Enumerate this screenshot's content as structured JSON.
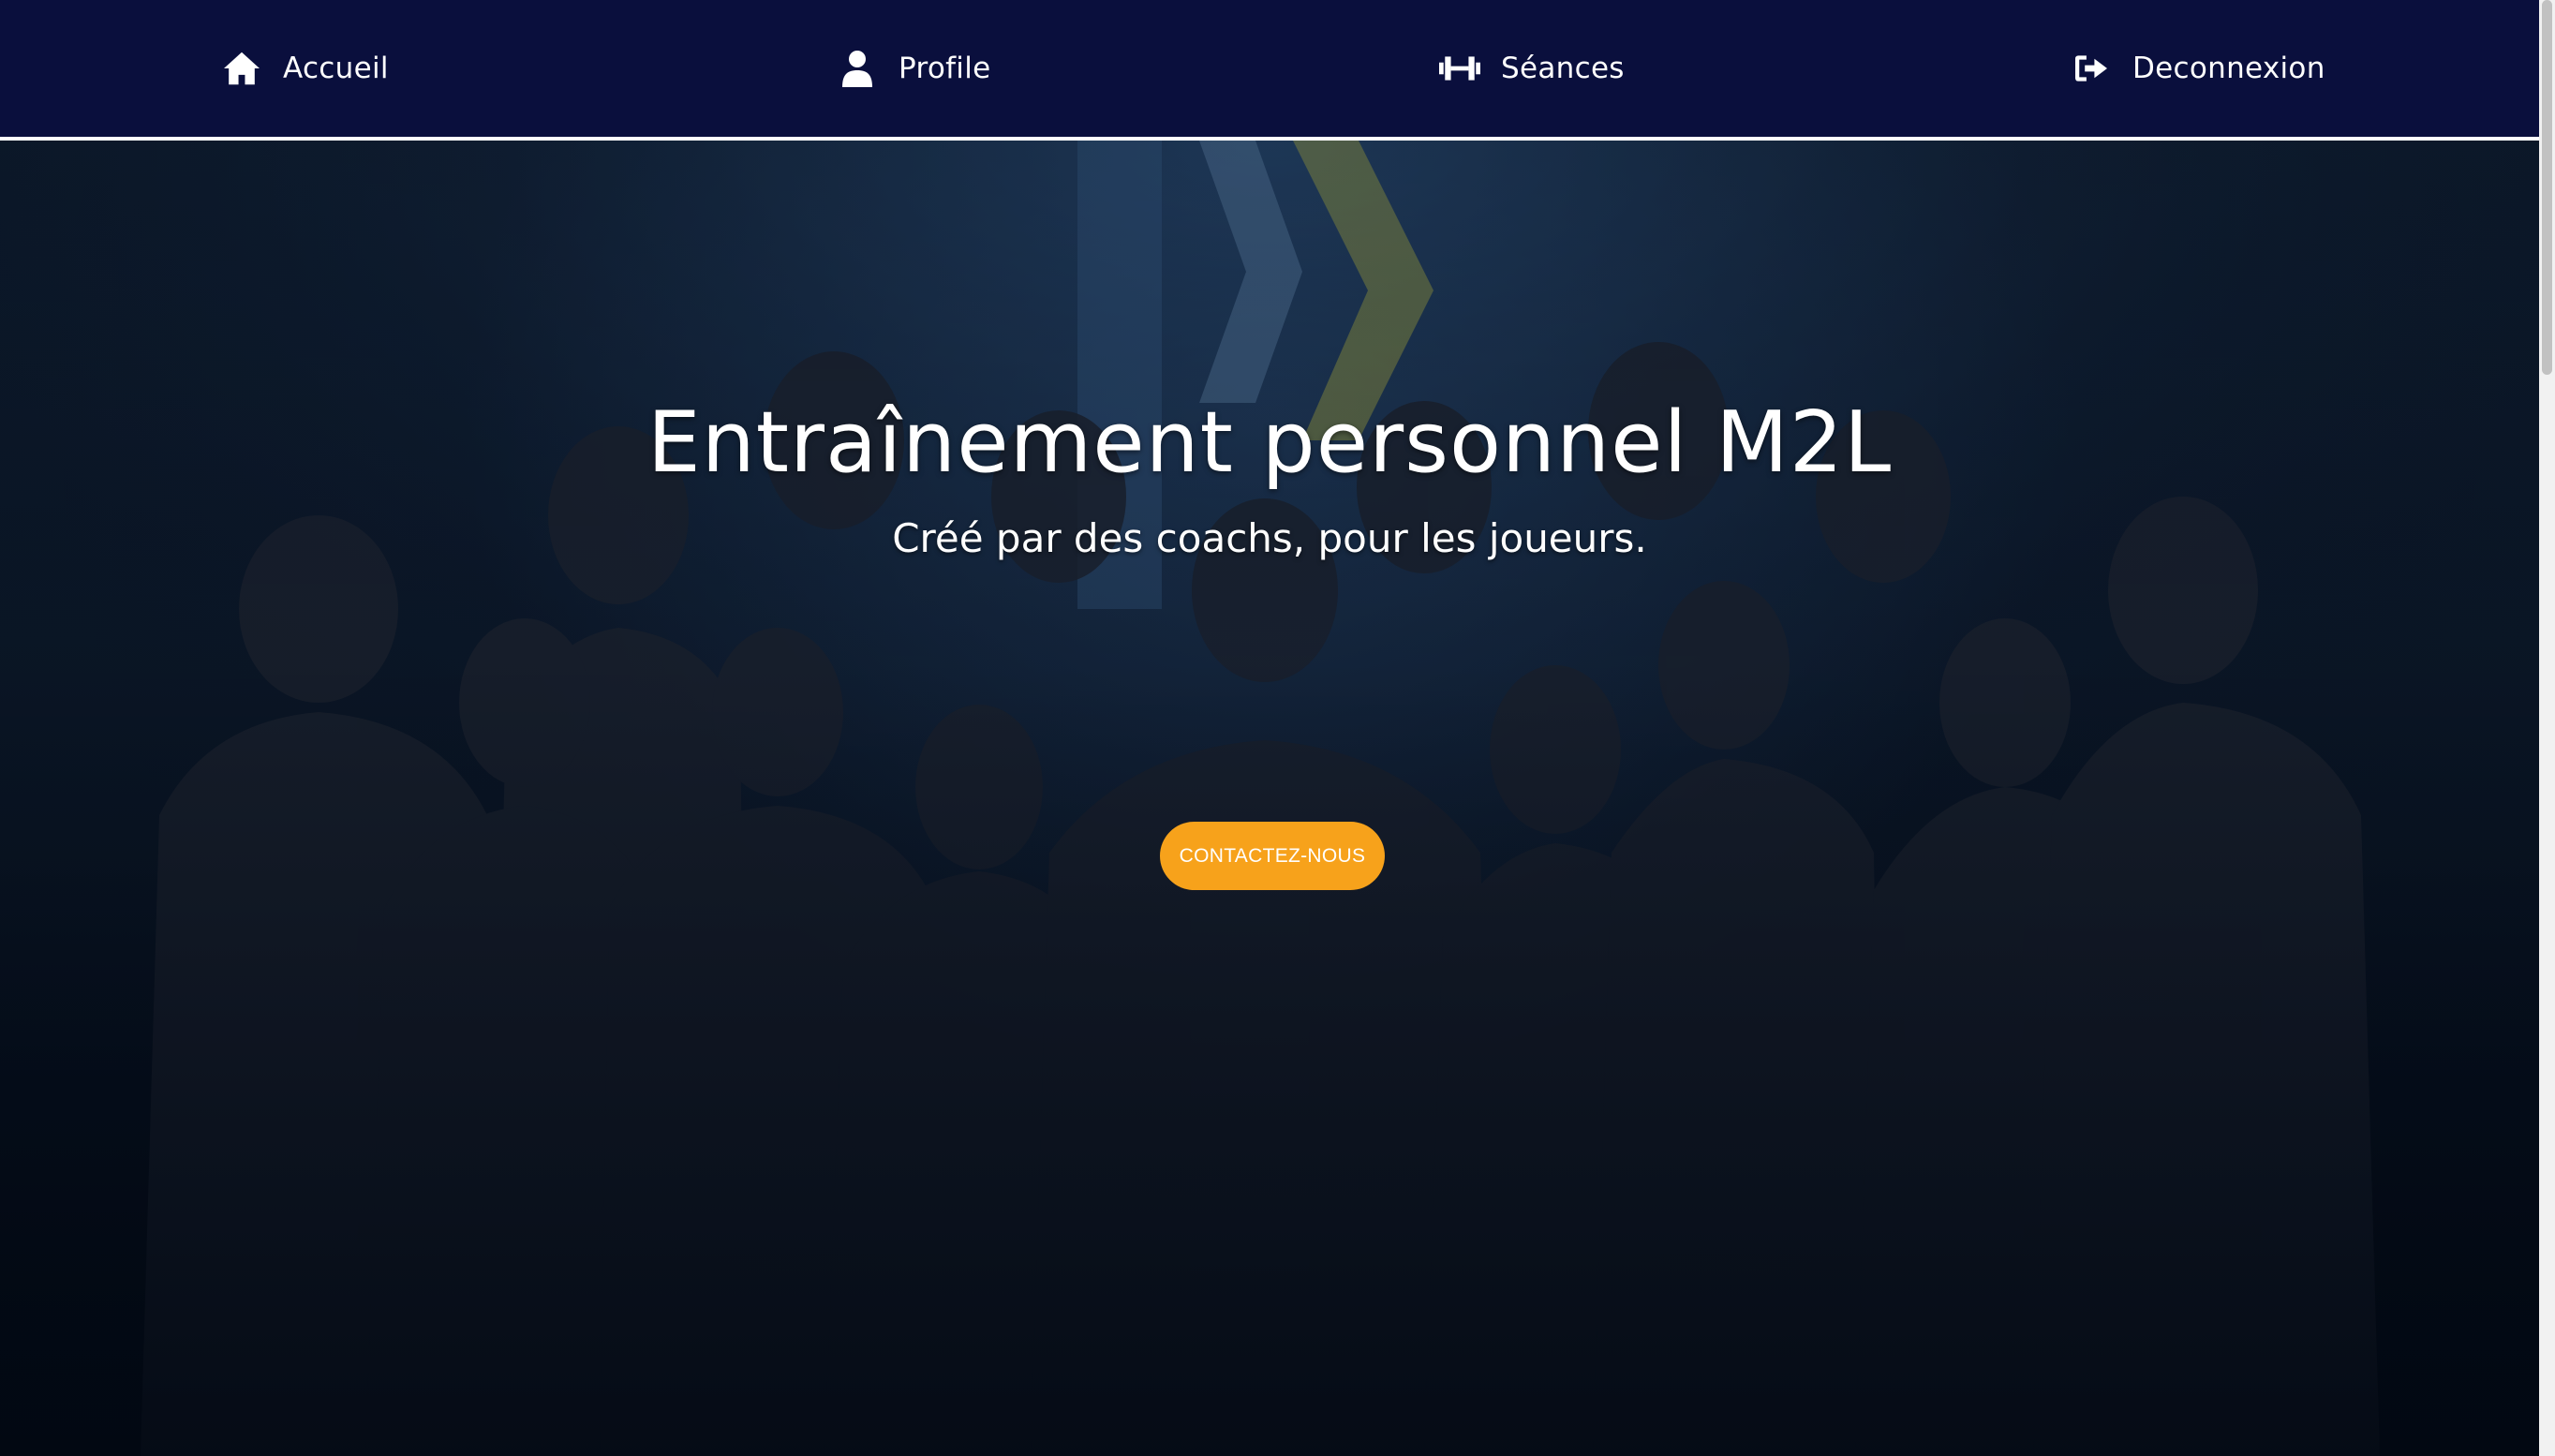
{
  "nav": {
    "items": [
      {
        "label": "Accueil",
        "icon": "home-icon"
      },
      {
        "label": "Profile",
        "icon": "user-icon"
      },
      {
        "label": "Séances",
        "icon": "dumbbell-icon"
      },
      {
        "label": "Deconnexion",
        "icon": "sign-out-icon"
      }
    ]
  },
  "hero": {
    "title": "Entraînement personnel M2L",
    "subtitle": "Créé par des coachs, pour les joueurs.",
    "cta_label": "CONTACTEZ-NOUS"
  },
  "colors": {
    "nav_background": "#0a0f3d",
    "cta_background": "#f7a21b",
    "text": "#ffffff"
  }
}
